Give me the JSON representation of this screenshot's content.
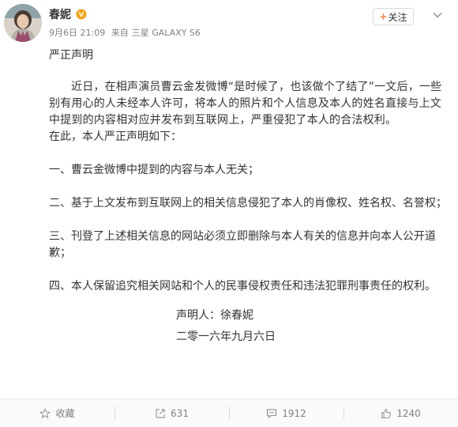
{
  "user": {
    "name": "春妮",
    "verified_badge": "orange-v-icon",
    "avatar": "avatar-photo"
  },
  "meta": {
    "date": "9月6日 21:09",
    "source_prefix": "来自",
    "device": "三星 GALAXY S6"
  },
  "follow_button": {
    "plus": "+",
    "label": "关注"
  },
  "post": {
    "title": "严正声明",
    "para1": "近日，在相声演员曹云金发微博“是时候了，也该做个了结了”一文后，一些别有用心的人未经本人许可，将本人的照片和个人信息及本人的姓名直接与上文中提到的内容相对应并发布到互联网上，严重侵犯了本人的合法权利。",
    "intro": "在此，本人严正声明如下：",
    "clauses": [
      "一、曹云金微博中提到的内容与本人无关；",
      "二、基于上文发布到互联网上的相关信息侵犯了本人的肖像权、姓名权、名誉权；",
      "三、刊登了上述相关信息的网站必须立即删除与本人有关的信息并向本人公开道歉；",
      "四、本人保留追究相关网站和个人的民事侵权责任和违法犯罪刑事责任的权利。"
    ],
    "signer": "声明人：徐春妮",
    "sign_date": "二零一六年九月六日"
  },
  "actions": {
    "favorite": {
      "label": "收藏",
      "icon": "star-icon"
    },
    "repost": {
      "count": "631",
      "icon": "repost-icon"
    },
    "comment": {
      "count": "1912",
      "icon": "comment-icon"
    },
    "like": {
      "count": "1240",
      "icon": "thumbs-up-icon"
    }
  },
  "colors": {
    "accent_orange": "#ff8140",
    "text_primary": "#333333",
    "text_secondary": "#808080"
  }
}
